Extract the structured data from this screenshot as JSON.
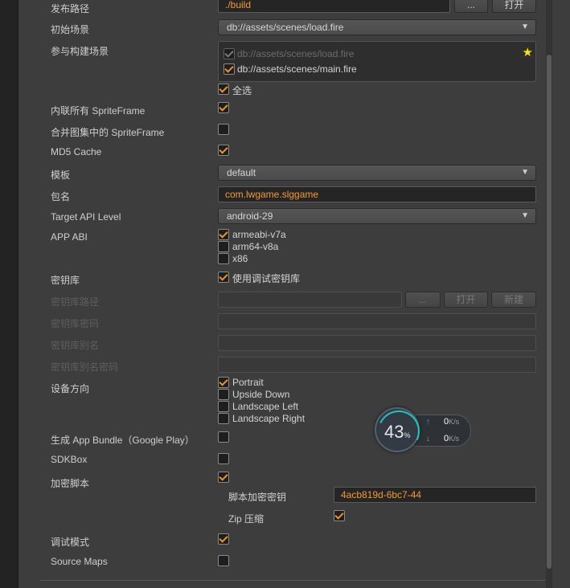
{
  "top": {
    "publish_path_label": "发布路径",
    "publish_path_value": "./build",
    "browse_button": "...",
    "open_button": "打开"
  },
  "start_scene": {
    "label": "初始场景",
    "value": "db://assets/scenes/load.fire"
  },
  "build_scenes": {
    "label": "参与构建场景",
    "items": [
      {
        "path": "db://assets/scenes/load.fire",
        "checked": true,
        "disabled": true,
        "starred": true
      },
      {
        "path": "db://assets/scenes/main.fire",
        "checked": true,
        "disabled": false
      }
    ],
    "select_all_label": "全选",
    "select_all_checked": true
  },
  "inline_spriteframe": {
    "label": "内联所有 SpriteFrame",
    "checked": true
  },
  "merge_spriteframe": {
    "label": "合并图集中的 SpriteFrame",
    "checked": false
  },
  "md5_cache": {
    "label": "MD5 Cache",
    "checked": true
  },
  "template": {
    "label": "模板",
    "value": "default"
  },
  "package_name": {
    "label": "包名",
    "value": "com.lwgame.slggame"
  },
  "target_api": {
    "label": "Target API Level",
    "value": "android-29"
  },
  "app_abi": {
    "label": "APP ABI",
    "options": [
      {
        "name": "armeabi-v7a",
        "checked": true
      },
      {
        "name": "arm64-v8a",
        "checked": false
      },
      {
        "name": "x86",
        "checked": false
      }
    ]
  },
  "keystore": {
    "label": "密钥库",
    "use_debug_label": "使用调试密钥库",
    "use_debug_checked": true,
    "path_label": "密钥库路径",
    "password_label": "密钥库密码",
    "alias_label": "密钥库别名",
    "alias_password_label": "密钥库别名密码",
    "browse_button": "...",
    "open_button": "打开",
    "new_button": "新建"
  },
  "orientation": {
    "label": "设备方向",
    "options": [
      {
        "name": "Portrait",
        "checked": true
      },
      {
        "name": "Upside Down",
        "checked": false
      },
      {
        "name": "Landscape Left",
        "checked": false
      },
      {
        "name": "Landscape Right",
        "checked": false
      }
    ]
  },
  "app_bundle": {
    "label": "生成 App Bundle（Google Play）",
    "checked": false
  },
  "sdkbox": {
    "label": "SDKBox",
    "checked": false
  },
  "encrypt_js": {
    "label": "加密脚本",
    "checked": true,
    "key_label": "脚本加密密钥",
    "key_value": "4acb819d-6bc7-44",
    "zip_label": "Zip 压缩",
    "zip_checked": true
  },
  "debug_mode": {
    "label": "调试模式",
    "checked": true
  },
  "source_maps": {
    "label": "Source Maps",
    "checked": false
  },
  "net_monitor": {
    "percent": "43",
    "percent_sign": "%",
    "upload_value": "0",
    "download_value": "0",
    "unit": "K/s",
    "upload_arrow": "↑",
    "download_arrow": "↓"
  },
  "colors": {
    "accent": "#ef9322",
    "gauge": "#19c6c0",
    "star": "#ffe100"
  },
  "icons": {
    "dropdown": "chevron-down-icon",
    "star": "star-icon",
    "check": "checkmark-icon"
  }
}
